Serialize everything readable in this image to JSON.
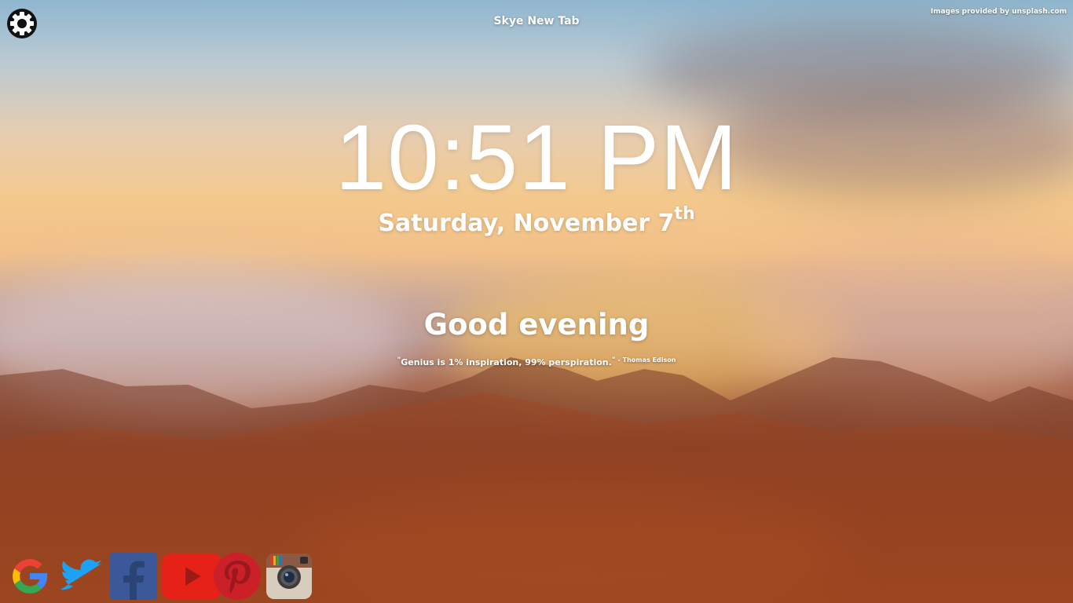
{
  "app": {
    "title": "Skye New Tab"
  },
  "credit": {
    "text": "Images provided by unsplash.com"
  },
  "clock": {
    "time": "10:51 PM"
  },
  "date": {
    "text": "Saturday, November 7",
    "suffix": "th"
  },
  "greeting": {
    "text": "Good evening"
  },
  "quote": {
    "open_mark": "\"",
    "text": "Genius is 1% inspiration, 99% perspiration.",
    "close_mark": "\"",
    "author": "- Thomas Edison"
  },
  "settings": {
    "icon": "gear-icon"
  },
  "shortcuts": [
    {
      "icon": "google-icon",
      "color": "#4285f4"
    },
    {
      "icon": "twitter-icon",
      "color": "#1da1f2"
    },
    {
      "icon": "facebook-icon",
      "color": "#3b5998"
    },
    {
      "icon": "youtube-icon",
      "color": "#e62117"
    },
    {
      "icon": "pinterest-icon",
      "color": "#cb2027"
    },
    {
      "icon": "instagram-icon",
      "color": "#8a5a44"
    }
  ]
}
